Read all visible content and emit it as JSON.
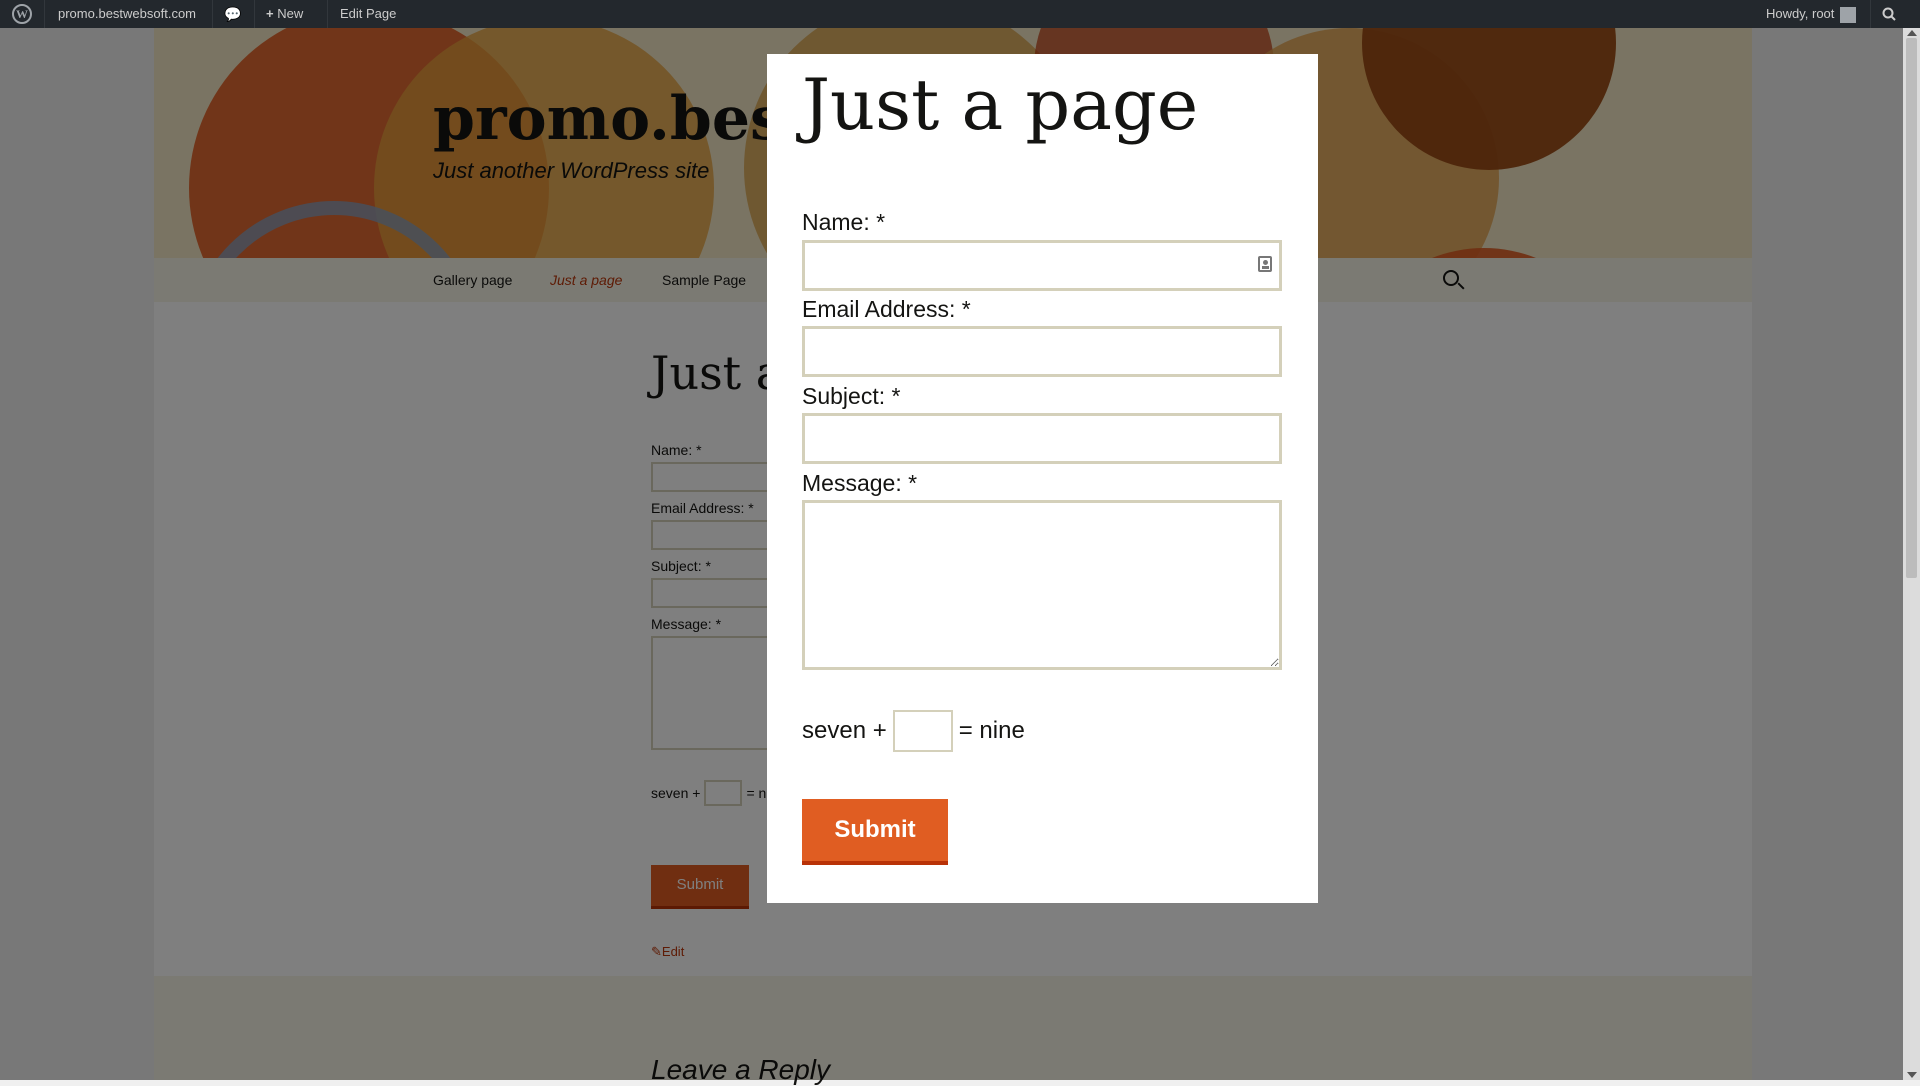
{
  "admin_bar": {
    "site_name": "promo.bestwebsoft.com",
    "new_label": "New",
    "edit_label": "Edit Page",
    "howdy": "Howdy, root"
  },
  "site": {
    "title": "promo.best",
    "description": "Just another WordPress site"
  },
  "nav": {
    "items": [
      {
        "label": "Gallery page"
      },
      {
        "label": "Just a page"
      },
      {
        "label": "Sample Page"
      }
    ]
  },
  "background_page": {
    "title": "Just a",
    "name_label": "Name: *",
    "email_label": "Email Address: *",
    "subject_label": "Subject: *",
    "message_label": "Message: *",
    "captcha_left": "seven +",
    "captcha_right": "= n",
    "submit_label": "Submit",
    "edit_label": "Edit",
    "reply_title": "Leave a Reply"
  },
  "modal": {
    "title": "Just a page",
    "name_label": "Name: *",
    "name_value": "",
    "email_label": "Email Address: *",
    "email_value": "",
    "subject_label": "Subject: *",
    "subject_value": "",
    "message_label": "Message: *",
    "message_value": "",
    "captcha_left": "seven +",
    "captcha_value": "",
    "captcha_right": "= nine",
    "submit_label": "Submit"
  },
  "colors": {
    "accent": "#e05d22",
    "accent_dark": "#b93207",
    "link": "#bc360a",
    "admin_bar": "#23282d"
  }
}
